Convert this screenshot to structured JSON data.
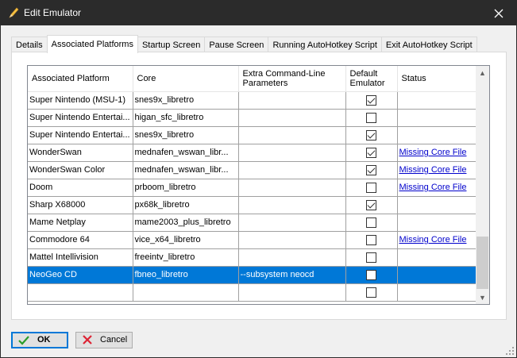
{
  "window": {
    "title": "Edit Emulator"
  },
  "tabs": [
    {
      "label": "Details",
      "active": false
    },
    {
      "label": "Associated Platforms",
      "active": true
    },
    {
      "label": "Startup Screen",
      "active": false
    },
    {
      "label": "Pause Screen",
      "active": false
    },
    {
      "label": "Running AutoHotkey Script",
      "active": false
    },
    {
      "label": "Exit AutoHotkey Script",
      "active": false
    }
  ],
  "grid": {
    "columns": [
      {
        "label": "Associated Platform"
      },
      {
        "label": "Core"
      },
      {
        "label": "Extra Command-Line Parameters"
      },
      {
        "label": "Default Emulator"
      },
      {
        "label": "Status"
      }
    ],
    "rows": [
      {
        "platform": "Super Nintendo (MSU-1)",
        "core": "snes9x_libretro",
        "params": "",
        "default": true,
        "status": ""
      },
      {
        "platform": "Super Nintendo Entertai...",
        "core": "higan_sfc_libretro",
        "params": "",
        "default": false,
        "status": ""
      },
      {
        "platform": "Super Nintendo Entertai...",
        "core": "snes9x_libretro",
        "params": "",
        "default": true,
        "status": ""
      },
      {
        "platform": "WonderSwan",
        "core": "mednafen_wswan_libr...",
        "params": "",
        "default": true,
        "status": "Missing Core File"
      },
      {
        "platform": "WonderSwan Color",
        "core": "mednafen_wswan_libr...",
        "params": "",
        "default": true,
        "status": "Missing Core File"
      },
      {
        "platform": "Doom",
        "core": "prboom_libretro",
        "params": "",
        "default": false,
        "status": "Missing Core File"
      },
      {
        "platform": "Sharp X68000",
        "core": "px68k_libretro",
        "params": "",
        "default": true,
        "status": ""
      },
      {
        "platform": "Mame Netplay",
        "core": "mame2003_plus_libretro",
        "params": "",
        "default": false,
        "status": ""
      },
      {
        "platform": "Commodore 64",
        "core": "vice_x64_libretro",
        "params": "",
        "default": false,
        "status": "Missing Core File"
      },
      {
        "platform": "Mattel Intellivision",
        "core": "freeintv_libretro",
        "params": "",
        "default": false,
        "status": ""
      },
      {
        "platform": "NeoGeo CD",
        "core": "fbneo_libretro",
        "params": "--subsystem neocd",
        "default": false,
        "status": "",
        "selected": true
      },
      {
        "platform": "",
        "core": "",
        "params": "",
        "default": false,
        "status": ""
      }
    ]
  },
  "buttons": {
    "ok": "OK",
    "cancel": "Cancel"
  },
  "colors": {
    "titlebar": "#2b2b2b",
    "selection": "#0078d7",
    "link": "#0000cc"
  }
}
